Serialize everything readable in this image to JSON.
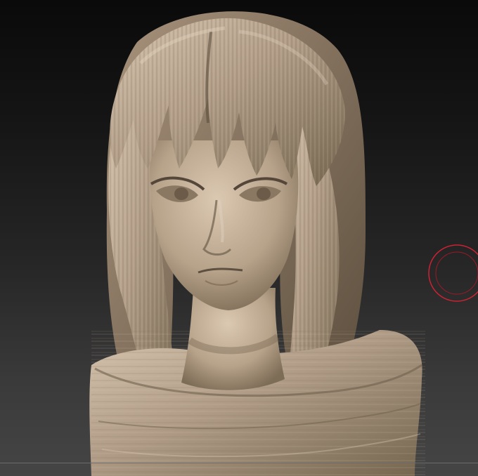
{
  "viewport": {
    "background_top": "#0a0a0a",
    "background_bottom": "#454545",
    "clay_color": "#b09c86",
    "clay_highlight": "#d8c7b2",
    "clay_shadow": "#5e5040",
    "brush_color": "#cc2233"
  },
  "model": {
    "subject": "sculpted-female-bust"
  }
}
